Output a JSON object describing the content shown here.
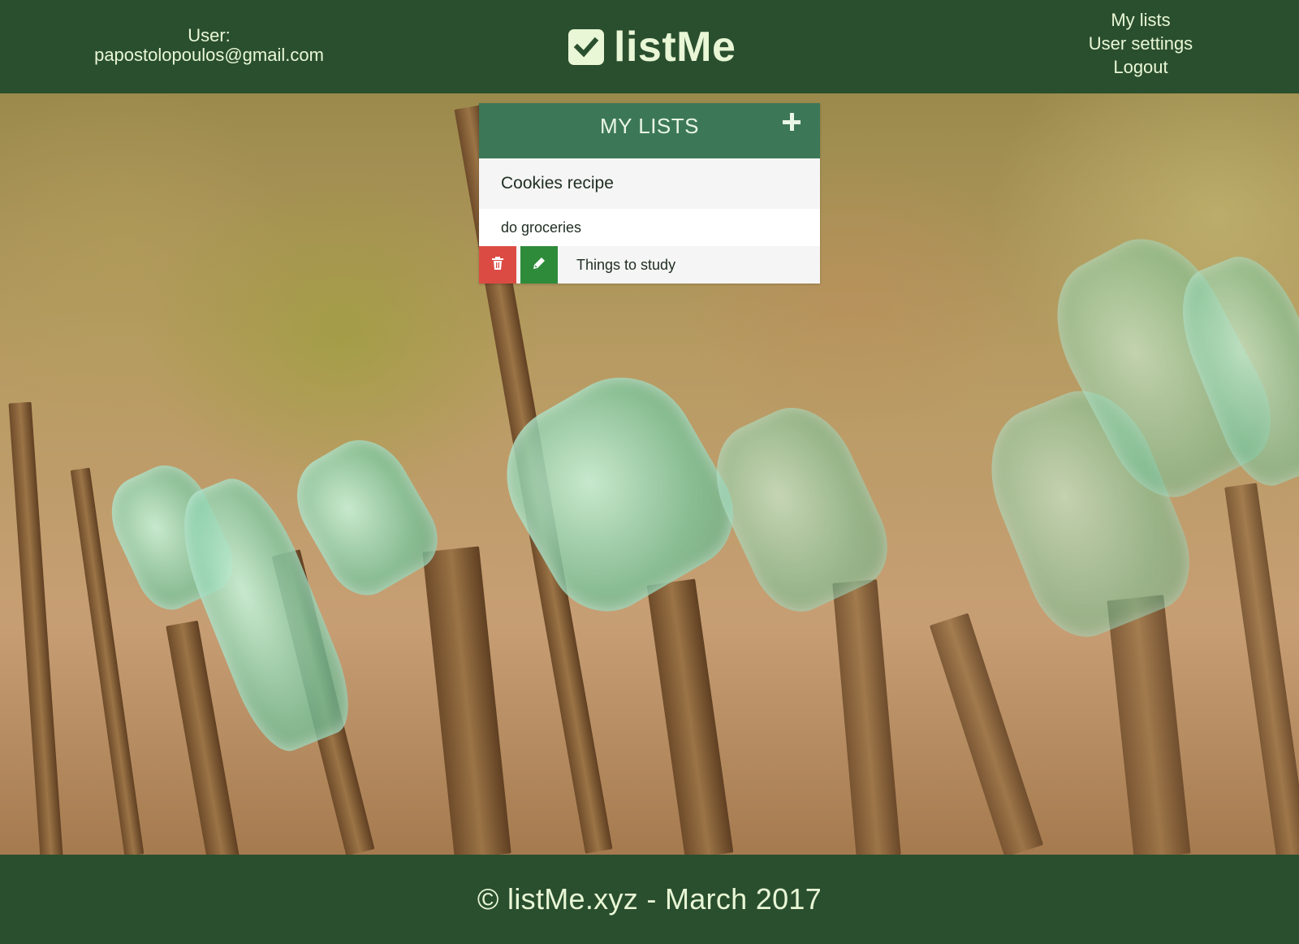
{
  "header": {
    "user_label": "User:",
    "user_email": "papostolopoulos@gmail.com",
    "brand": "listMe",
    "brand_icon": "checkbox-icon",
    "nav": {
      "my_lists": "My lists",
      "user_settings": "User settings",
      "logout": "Logout"
    }
  },
  "lists_card": {
    "title": "MY LISTS",
    "add_icon": "plus-icon",
    "items": [
      {
        "label": "Cookies recipe"
      },
      {
        "label": "do groceries"
      },
      {
        "label": "Things to study",
        "actions": {
          "delete_icon": "trash-icon",
          "edit_icon": "pencil-icon"
        }
      }
    ]
  },
  "footer": {
    "text": "© listMe.xyz - March 2017"
  },
  "colors": {
    "header_bg": "#2a4f2e",
    "header_text": "#e9f7d6",
    "card_header_bg": "#3c7857",
    "delete_bg": "#dc4b43",
    "edit_bg": "#2e8b3a"
  }
}
